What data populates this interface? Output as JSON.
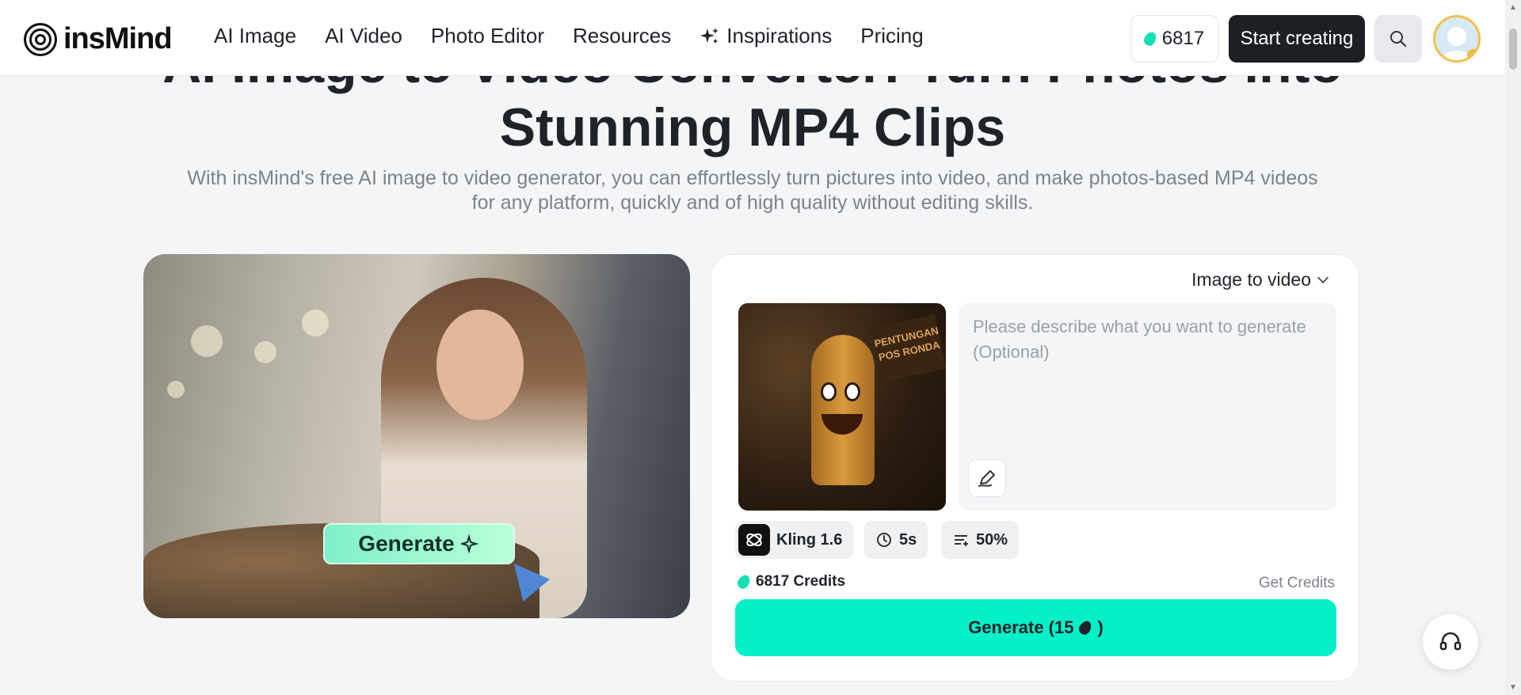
{
  "header": {
    "logo_text": "insMind",
    "nav": [
      "AI Image",
      "AI Video",
      "Photo Editor",
      "Resources",
      "Inspirations",
      "Pricing"
    ],
    "credits": "6817",
    "start_label": "Start creating"
  },
  "hero": {
    "title_line1": "AI Image to Video Converter: Turn Photos into",
    "title_line2": "Stunning MP4 Clips",
    "subtitle": "With insMind's free AI image to video generator, you can effortlessly turn pictures into video, and make photos-based MP4 videos for any platform, quickly and of high quality without editing skills."
  },
  "demo": {
    "button_label": "Generate"
  },
  "panel": {
    "mode": "Image to video",
    "thumbnail_sign": "PENTUNGAN POS RONDA",
    "prompt_placeholder": "Please describe what you want to generate (Optional)",
    "model": "Kling 1.6",
    "duration": "5s",
    "percent": "50%",
    "credits_text": "6817 Credits",
    "get_credits": "Get Credits",
    "generate_prefix": "Generate (15",
    "generate_suffix": ")"
  },
  "colors": {
    "accent": "#05f0c8",
    "dark": "#1c1f23",
    "gem": "#14e0b5"
  }
}
